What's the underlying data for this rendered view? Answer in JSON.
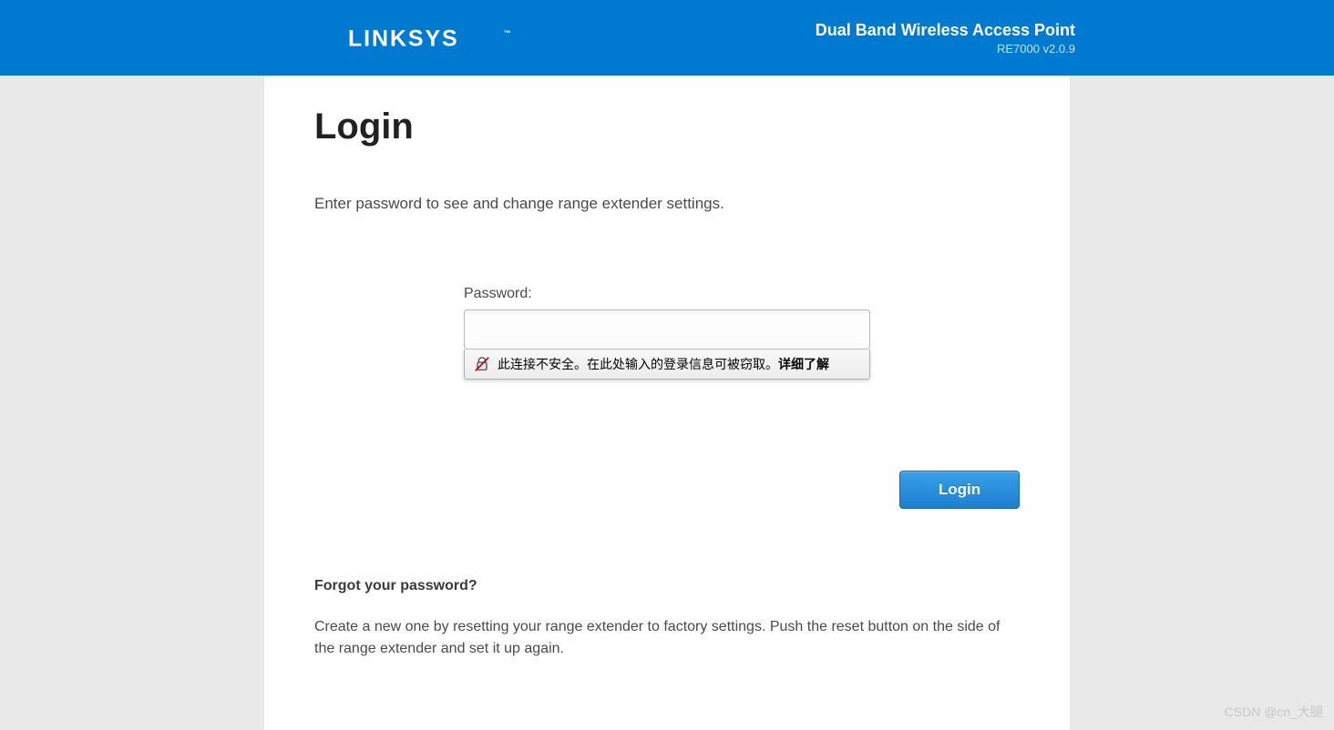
{
  "header": {
    "brand": "LINKSYS",
    "product_name": "Dual Band Wireless Access Point",
    "product_version": "RE7000 v2.0.9"
  },
  "login": {
    "title": "Login",
    "instruction": "Enter password to see and change range extender settings.",
    "password_label": "Password:",
    "password_value": "",
    "button_label": "Login"
  },
  "warning": {
    "text": "此连接不安全。在此处输入的登录信息可被窃取。",
    "link": "详细了解"
  },
  "forgot": {
    "title": "Forgot your password?",
    "text": "Create a new one by resetting your range extender to factory settings. Push the reset button on the side of the range extender and set it up again."
  },
  "watermark": "CSDN @cn_大腿"
}
